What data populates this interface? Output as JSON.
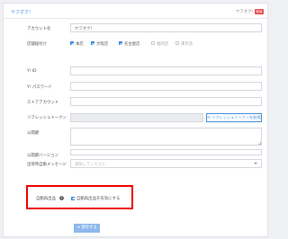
{
  "header": {
    "title": "ヤフオク！",
    "account": "ヤフオク!",
    "badge": "削除"
  },
  "fields": {
    "account_name": {
      "label": "アカウント名",
      "value": "ヤフオク！"
    },
    "store_setting": {
      "label": "店舗紐付け",
      "options": [
        {
          "label": "本店",
          "checked": true
        },
        {
          "label": "大阪店",
          "checked": true
        },
        {
          "label": "名古屋店",
          "checked": true
        },
        {
          "label": "福岡店",
          "checked": false
        },
        {
          "label": "東京店",
          "checked": false
        }
      ]
    },
    "yid": {
      "label": "Y! ID"
    },
    "yid_password": {
      "label": "Y! パスワード"
    },
    "store_account": {
      "label": "ストアアカウント"
    },
    "refresh_token": {
      "label": "リフレッシュトークン",
      "button": "リフレッシュトークンを取得"
    },
    "public_key": {
      "label": "公開鍵"
    },
    "public_key_version": {
      "label": "公開鍵バージョン"
    },
    "auto_message": {
      "label": "出荷時自動メッセージ",
      "placeholder": "選択してください"
    },
    "auto_relist": {
      "label": "自動再出品",
      "help": "?",
      "checkbox_label": "自動再出品を有効にする",
      "checked": true
    }
  },
  "actions": {
    "save_label": "保存する",
    "save_icon": "arrow-right-icon"
  },
  "colors": {
    "accent": "#3d8fe0",
    "badge": "#e94b4b",
    "highlight": "#e00000"
  }
}
